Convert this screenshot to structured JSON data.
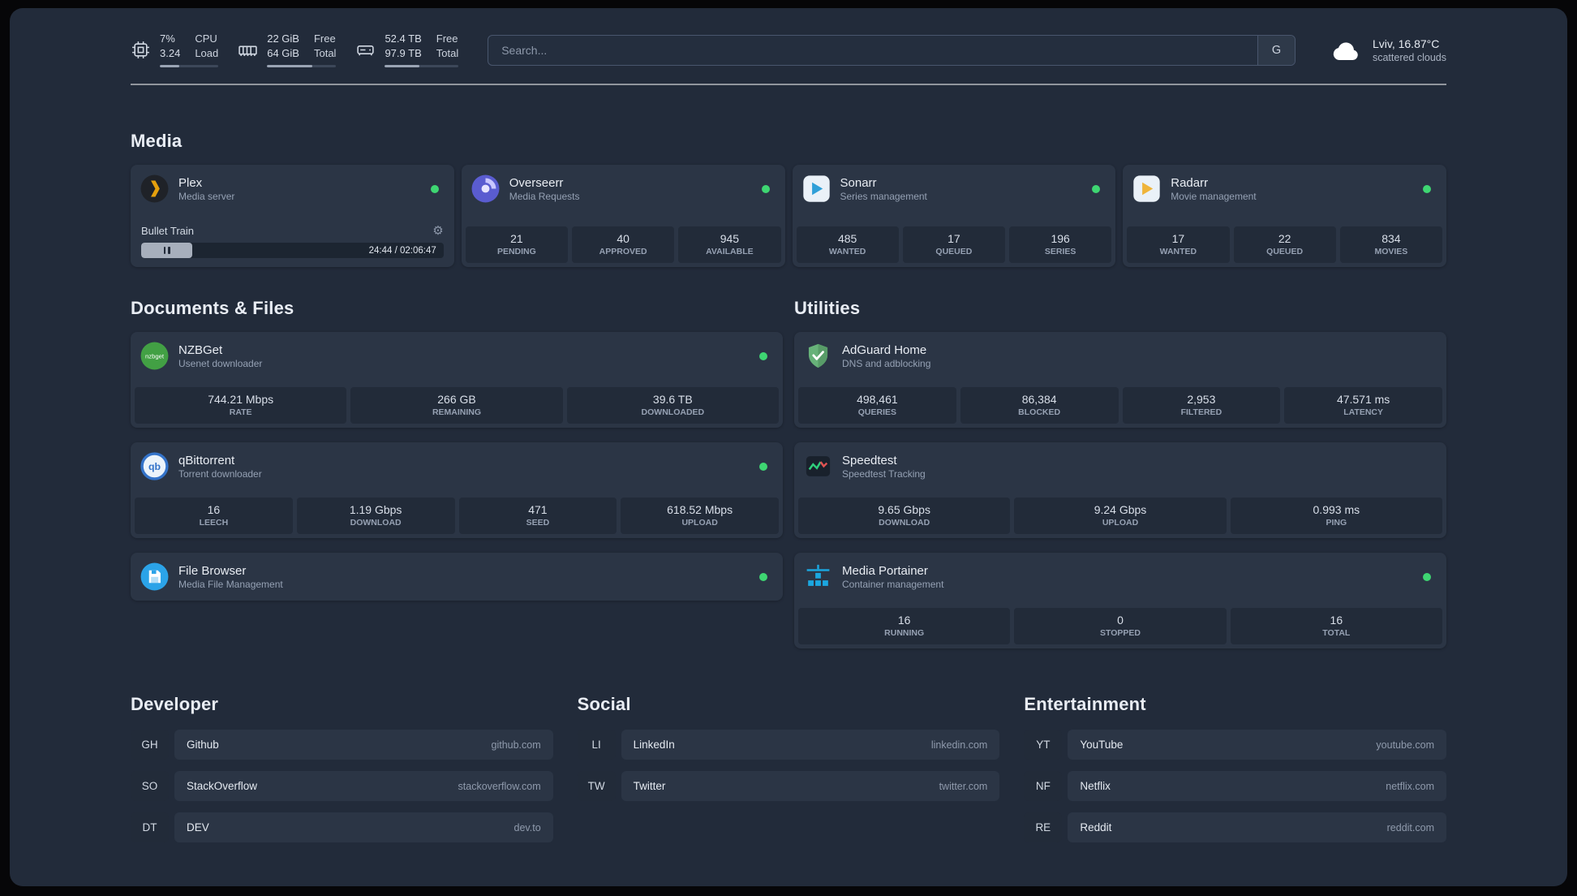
{
  "topbar": {
    "cpu": {
      "value_top": "7%",
      "label_top": "CPU",
      "value_bottom": "3.24",
      "label_bottom": "Load",
      "bar_percent": 33
    },
    "memory": {
      "value_top": "22 GiB",
      "label_top": "Free",
      "value_bottom": "64 GiB",
      "label_bottom": "Total",
      "bar_percent": 65
    },
    "disk": {
      "value_top": "52.4 TB",
      "label_top": "Free",
      "value_bottom": "97.9 TB",
      "label_bottom": "Total",
      "bar_percent": 47
    },
    "search_placeholder": "Search...",
    "search_button": "G",
    "weather_location": "Lviv, 16.87°C",
    "weather_condition": "scattered clouds"
  },
  "icons": {
    "gear_glyph": "⚙",
    "nzbget_icon_text": "nzbget",
    "qbittorrent_icon_text": "qb"
  },
  "colors": {
    "status_online": "#3ed672",
    "plex_accent": "#e5a00d",
    "overseerr_accent": "#5a5cd0",
    "sonarr_accent": "#2f9fd8",
    "radarr_accent": "#efb43a",
    "nzbget_accent": "#42a044",
    "qbittorrent_accent": "#3473c9",
    "filebrowser_accent": "#2ba3e8",
    "adguard_accent": "#67b279",
    "speedtest_accent": "#2fd07c",
    "portainer_accent": "#1ba7e0"
  },
  "media": {
    "title": "Media",
    "plex": {
      "name": "Plex",
      "desc": "Media server",
      "now_playing": "Bullet Train",
      "time": "24:44 / 02:06:47",
      "progress_percent": 17
    },
    "overseerr": {
      "name": "Overseerr",
      "desc": "Media Requests",
      "stats": [
        {
          "value": "21",
          "label": "PENDING"
        },
        {
          "value": "40",
          "label": "APPROVED"
        },
        {
          "value": "945",
          "label": "AVAILABLE"
        }
      ]
    },
    "sonarr": {
      "name": "Sonarr",
      "desc": "Series management",
      "stats": [
        {
          "value": "485",
          "label": "WANTED"
        },
        {
          "value": "17",
          "label": "QUEUED"
        },
        {
          "value": "196",
          "label": "SERIES"
        }
      ]
    },
    "radarr": {
      "name": "Radarr",
      "desc": "Movie management",
      "stats": [
        {
          "value": "17",
          "label": "WANTED"
        },
        {
          "value": "22",
          "label": "QUEUED"
        },
        {
          "value": "834",
          "label": "MOVIES"
        }
      ]
    }
  },
  "documents": {
    "title": "Documents & Files",
    "nzbget": {
      "name": "NZBGet",
      "desc": "Usenet downloader",
      "stats": [
        {
          "value": "744.21 Mbps",
          "label": "RATE"
        },
        {
          "value": "266 GB",
          "label": "REMAINING"
        },
        {
          "value": "39.6 TB",
          "label": "DOWNLOADED"
        }
      ]
    },
    "qbittorrent": {
      "name": "qBittorrent",
      "desc": "Torrent downloader",
      "stats": [
        {
          "value": "16",
          "label": "LEECH"
        },
        {
          "value": "1.19 Gbps",
          "label": "DOWNLOAD"
        },
        {
          "value": "471",
          "label": "SEED"
        },
        {
          "value": "618.52 Mbps",
          "label": "UPLOAD"
        }
      ]
    },
    "filebrowser": {
      "name": "File Browser",
      "desc": "Media File Management"
    }
  },
  "utilities": {
    "title": "Utilities",
    "adguard": {
      "name": "AdGuard Home",
      "desc": "DNS and adblocking",
      "stats": [
        {
          "value": "498,461",
          "label": "QUERIES"
        },
        {
          "value": "86,384",
          "label": "BLOCKED"
        },
        {
          "value": "2,953",
          "label": "FILTERED"
        },
        {
          "value": "47.571 ms",
          "label": "LATENCY"
        }
      ]
    },
    "speedtest": {
      "name": "Speedtest",
      "desc": "Speedtest Tracking",
      "stats": [
        {
          "value": "9.65 Gbps",
          "label": "DOWNLOAD"
        },
        {
          "value": "9.24 Gbps",
          "label": "UPLOAD"
        },
        {
          "value": "0.993 ms",
          "label": "PING"
        }
      ]
    },
    "portainer": {
      "name": "Media Portainer",
      "desc": "Container management",
      "stats": [
        {
          "value": "16",
          "label": "RUNNING"
        },
        {
          "value": "0",
          "label": "STOPPED"
        },
        {
          "value": "16",
          "label": "TOTAL"
        }
      ]
    }
  },
  "bookmarks": {
    "developer": {
      "title": "Developer",
      "items": [
        {
          "abbr": "GH",
          "name": "Github",
          "domain": "github.com"
        },
        {
          "abbr": "SO",
          "name": "StackOverflow",
          "domain": "stackoverflow.com"
        },
        {
          "abbr": "DT",
          "name": "DEV",
          "domain": "dev.to"
        }
      ]
    },
    "social": {
      "title": "Social",
      "items": [
        {
          "abbr": "LI",
          "name": "LinkedIn",
          "domain": "linkedin.com"
        },
        {
          "abbr": "TW",
          "name": "Twitter",
          "domain": "twitter.com"
        }
      ]
    },
    "entertainment": {
      "title": "Entertainment",
      "items": [
        {
          "abbr": "YT",
          "name": "YouTube",
          "domain": "youtube.com"
        },
        {
          "abbr": "NF",
          "name": "Netflix",
          "domain": "netflix.com"
        },
        {
          "abbr": "RE",
          "name": "Reddit",
          "domain": "reddit.com"
        }
      ]
    }
  }
}
